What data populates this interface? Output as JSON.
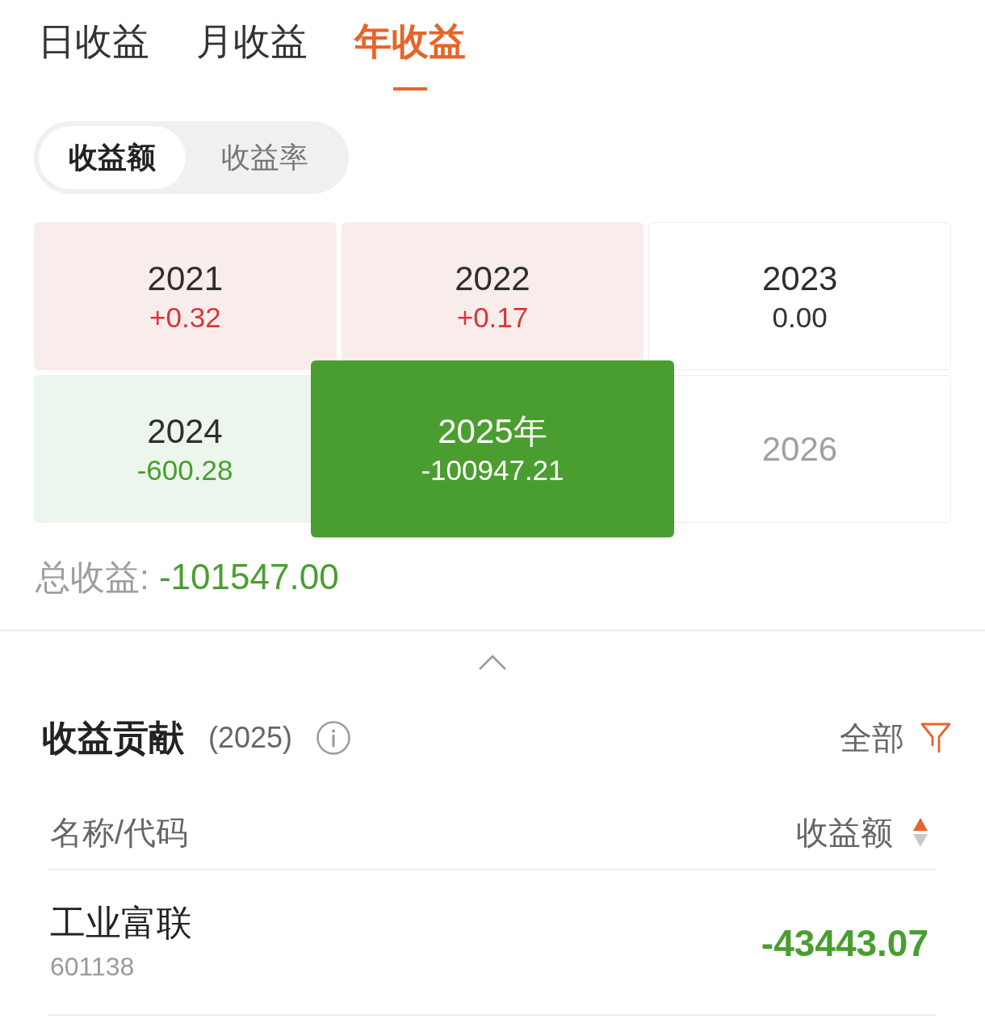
{
  "period_tabs": [
    {
      "label": "日收益",
      "selected": false
    },
    {
      "label": "月收益",
      "selected": false
    },
    {
      "label": "年收益",
      "selected": true
    }
  ],
  "metric_toggle": [
    {
      "label": "收益额",
      "selected": true
    },
    {
      "label": "收益率",
      "selected": false
    }
  ],
  "year_grid": [
    {
      "year": "2021",
      "value": "+0.32",
      "kind": "gain",
      "selected": false
    },
    {
      "year": "2022",
      "value": "+0.17",
      "kind": "gain",
      "selected": false
    },
    {
      "year": "2023",
      "value": "0.00",
      "kind": "flat",
      "selected": false
    },
    {
      "year": "2024",
      "value": "-600.28",
      "kind": "loss",
      "selected": false
    },
    {
      "year": "2025年",
      "value": "-100947.21",
      "kind": "loss",
      "selected": true
    },
    {
      "year": "2026",
      "kind": "future",
      "selected": false
    }
  ],
  "total": {
    "label": "总收益:",
    "value": "-101547.00",
    "kind": "loss"
  },
  "contribution": {
    "title": "收益贡献",
    "year": "(2025)",
    "filter_label": "全部",
    "columns": [
      {
        "label": "名称/代码"
      },
      {
        "label": "收益额",
        "ascending": true
      }
    ],
    "rows": [
      {
        "name": "工业富联",
        "code": "601138",
        "value": "-43443.07",
        "kind": "loss"
      }
    ]
  }
}
